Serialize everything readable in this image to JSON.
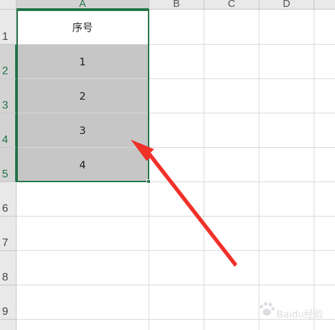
{
  "columns": [
    "A",
    "B",
    "C",
    "D"
  ],
  "rows": [
    "1",
    "2",
    "3",
    "4",
    "5",
    "6",
    "7",
    "8",
    "9"
  ],
  "cells": {
    "A1": "序号",
    "A2": "1",
    "A3": "2",
    "A4": "3",
    "A5": "4"
  },
  "selection": {
    "range": "A2:A5",
    "border_color": "#217346",
    "fill_color": "#c6c6c6"
  },
  "annotation": {
    "type": "arrow",
    "color": "#f0312a",
    "points_to": "A4"
  },
  "watermark": {
    "text": "Baidu经验",
    "icon": "baidu-paw-icon"
  }
}
